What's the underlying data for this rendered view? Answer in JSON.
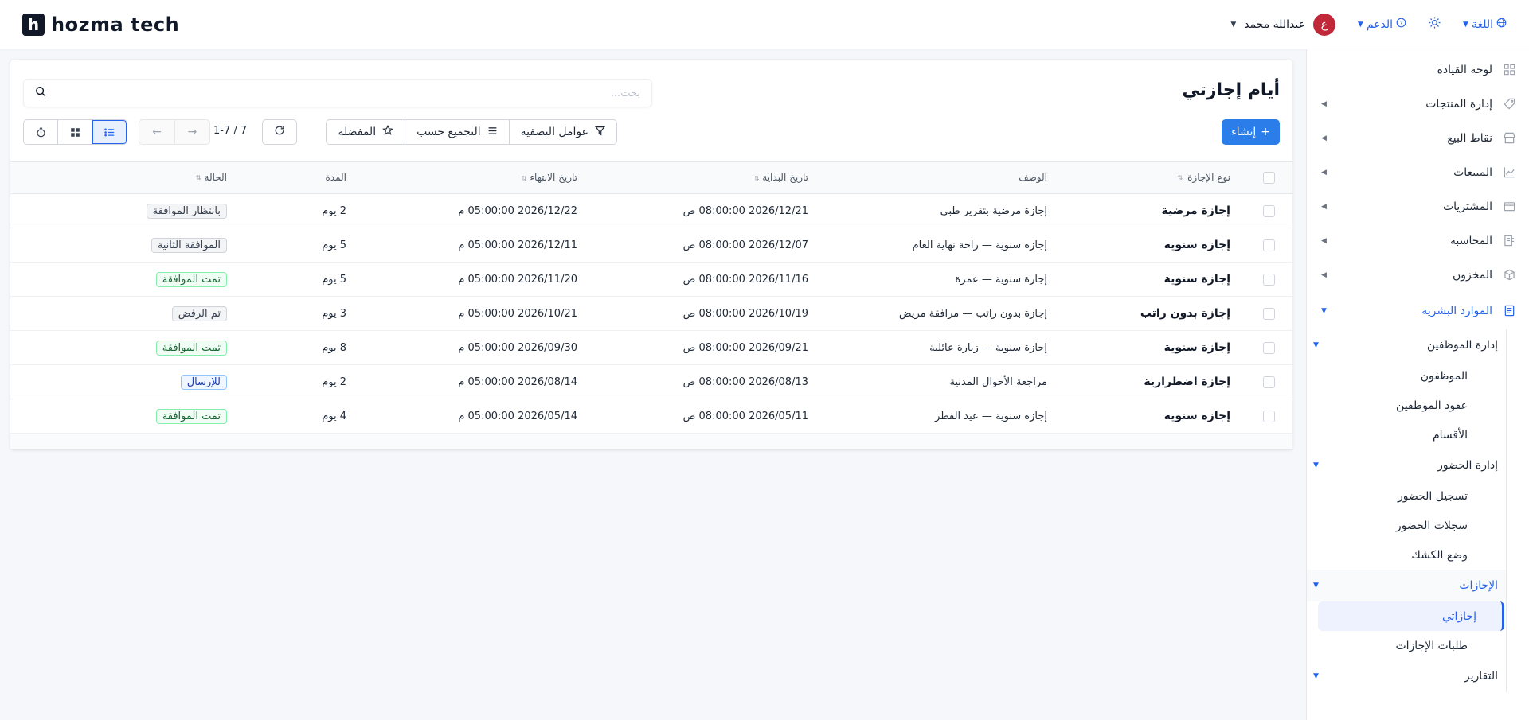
{
  "brand": {
    "logo_letter": "h",
    "name": "hozma tech"
  },
  "header": {
    "user_name": "عبدالله محمد",
    "avatar_letter": "ع",
    "support_label": "الدعم",
    "language_label": "اللغة"
  },
  "sidebar": {
    "items": [
      {
        "label": "لوحة القيادة",
        "icon": "grid-icon"
      },
      {
        "label": "إدارة المنتجات",
        "icon": "tag-icon"
      },
      {
        "label": "نقاط البيع",
        "icon": "store-icon"
      },
      {
        "label": "المبيعات",
        "icon": "chart-icon"
      },
      {
        "label": "المشتريات",
        "icon": "wallet-icon"
      },
      {
        "label": "المحاسبة",
        "icon": "ledger-icon"
      },
      {
        "label": "المخزون",
        "icon": "box-icon"
      },
      {
        "label": "الموارد البشرية",
        "icon": "document-icon"
      }
    ],
    "hr_groups": [
      {
        "label": "إدارة الموظفين",
        "children": [
          "الموظفون",
          "عقود الموظفين",
          "الأقسام"
        ]
      },
      {
        "label": "إدارة الحضور",
        "children": [
          "تسجيل الحضور",
          "سجلات الحضور",
          "وضع الكشك"
        ]
      },
      {
        "label": "الإجازات",
        "children": [
          "إجازاتي",
          "طلبات الإجازات"
        ]
      },
      {
        "label": "التقارير",
        "children": []
      }
    ]
  },
  "page": {
    "title": "أيام إجازتي",
    "search_placeholder": "بحث...",
    "create_label": "إنشاء",
    "filters_label": "عوامل التصفية",
    "groupby_label": "التجميع حسب",
    "favorites_label": "المفضلة",
    "pager_text": "1-7 / 7"
  },
  "table": {
    "headers": {
      "type": "نوع الإجازة",
      "description": "الوصف",
      "start": "تاريخ البداية",
      "end": "تاريخ الانتهاء",
      "duration": "المدة",
      "status": "الحالة"
    },
    "rows": [
      {
        "type": "إجازة مرضية",
        "description": "إجازة مرضية بتقرير طبي",
        "start": "2026/12/21 08:00:00 ص",
        "end": "2026/12/22 05:00:00 م",
        "duration": "2 يوم",
        "status": "بانتظار الموافقة",
        "status_style": "gray"
      },
      {
        "type": "إجازة سنوية",
        "description": "إجازة سنوية — راحة نهاية العام",
        "start": "2026/12/07 08:00:00 ص",
        "end": "2026/12/11 05:00:00 م",
        "duration": "5 يوم",
        "status": "الموافقة الثانية",
        "status_style": "gray"
      },
      {
        "type": "إجازة سنوية",
        "description": "إجازة سنوية — عمرة",
        "start": "2026/11/16 08:00:00 ص",
        "end": "2026/11/20 05:00:00 م",
        "duration": "5 يوم",
        "status": "تمت الموافقة",
        "status_style": "green"
      },
      {
        "type": "إجازة بدون راتب",
        "description": "إجازة بدون راتب — مرافقة مريض",
        "start": "2026/10/19 08:00:00 ص",
        "end": "2026/10/21 05:00:00 م",
        "duration": "3 يوم",
        "status": "تم الرفض",
        "status_style": "gray"
      },
      {
        "type": "إجازة سنوية",
        "description": "إجازة سنوية — زيارة عائلية",
        "start": "2026/09/21 08:00:00 ص",
        "end": "2026/09/30 05:00:00 م",
        "duration": "8 يوم",
        "status": "تمت الموافقة",
        "status_style": "green"
      },
      {
        "type": "إجازة اضطرارية",
        "description": "مراجعة الأحوال المدنية",
        "start": "2026/08/13 08:00:00 ص",
        "end": "2026/08/14 05:00:00 م",
        "duration": "2 يوم",
        "status": "للإرسال",
        "status_style": "blue"
      },
      {
        "type": "إجازة سنوية",
        "description": "إجازة سنوية — عيد الفطر",
        "start": "2026/05/11 08:00:00 ص",
        "end": "2026/05/14 05:00:00 م",
        "duration": "4 يوم",
        "status": "تمت الموافقة",
        "status_style": "green"
      }
    ]
  },
  "colors": {
    "accent": "#2b7de9",
    "avatar": "#c0283a"
  }
}
